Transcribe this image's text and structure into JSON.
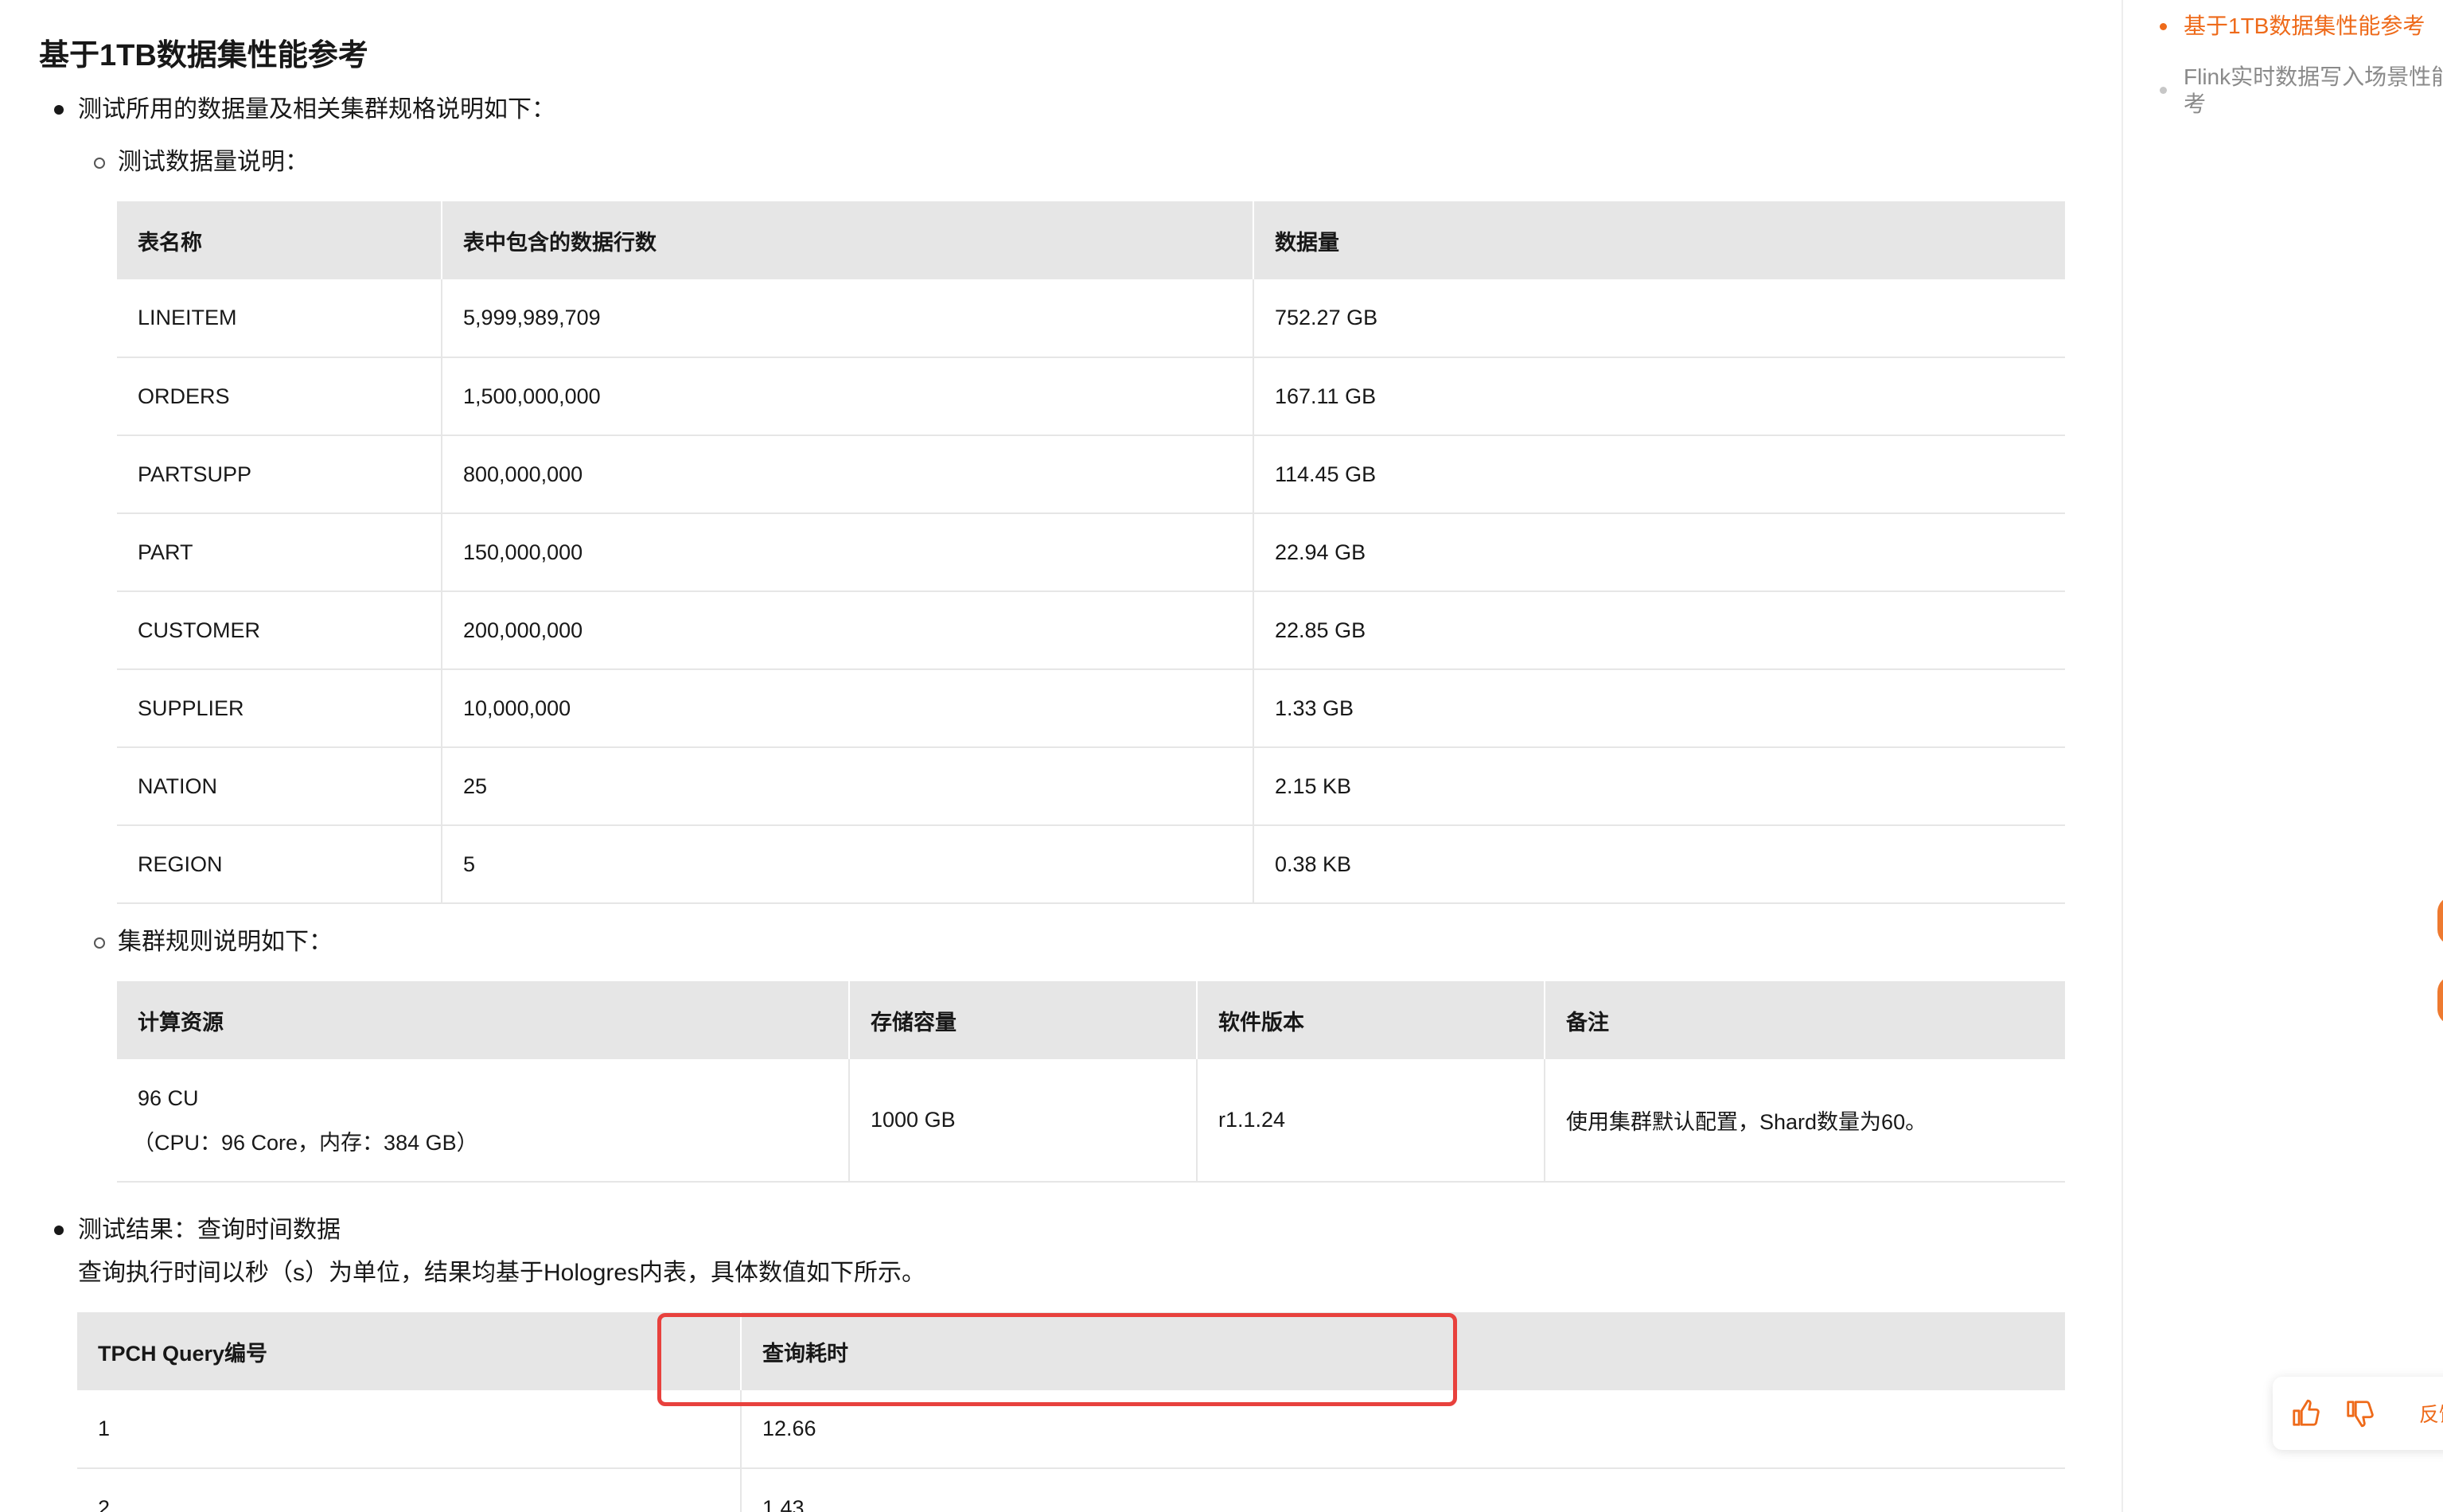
{
  "page": {
    "title": "基于1TB数据集性能参考",
    "bullet1": "测试所用的数据量及相关集群规格说明如下：",
    "sub1": "测试数据量说明：",
    "sub2": "集群规则说明如下：",
    "bullet2": "测试结果：查询时间数据",
    "bullet2_desc": "查询执行时间以秒（s）为单位，结果均基于Hologres内表，具体数值如下所示。"
  },
  "data_table": {
    "headers": [
      "表名称",
      "表中包含的数据行数",
      "数据量"
    ],
    "rows": [
      [
        "LINEITEM",
        "5,999,989,709",
        "752.27 GB"
      ],
      [
        "ORDERS",
        "1,500,000,000",
        "167.11 GB"
      ],
      [
        "PARTSUPP",
        "800,000,000",
        "114.45 GB"
      ],
      [
        "PART",
        "150,000,000",
        "22.94 GB"
      ],
      [
        "CUSTOMER",
        "200,000,000",
        "22.85 GB"
      ],
      [
        "SUPPLIER",
        "10,000,000",
        "1.33 GB"
      ],
      [
        "NATION",
        "25",
        "2.15 KB"
      ],
      [
        "REGION",
        "5",
        "0.38 KB"
      ]
    ]
  },
  "cluster_table": {
    "headers": [
      "计算资源",
      "存储容量",
      "软件版本",
      "备注"
    ],
    "row": {
      "compute_line1": "96 CU",
      "compute_line2": "（CPU：96 Core，内存：384 GB）",
      "storage": "1000 GB",
      "version": "r1.1.24",
      "note": "使用集群默认配置，Shard数量为60。"
    }
  },
  "query_table": {
    "headers": [
      "TPCH Query编号",
      "查询耗时"
    ],
    "rows": [
      [
        "1",
        "12.66"
      ],
      [
        "2",
        "1.43"
      ]
    ]
  },
  "toc": {
    "items": [
      {
        "label": "基于1TB数据集性能参考",
        "active": true
      },
      {
        "label_line1": "Flink实时数据写入场景性能",
        "label_line2": "考",
        "active": false
      }
    ]
  },
  "feedback": {
    "label": "反馈"
  },
  "colors": {
    "accent": "#ee6a1a",
    "highlight": "#e8413d",
    "header_bg": "#e6e6e6"
  }
}
